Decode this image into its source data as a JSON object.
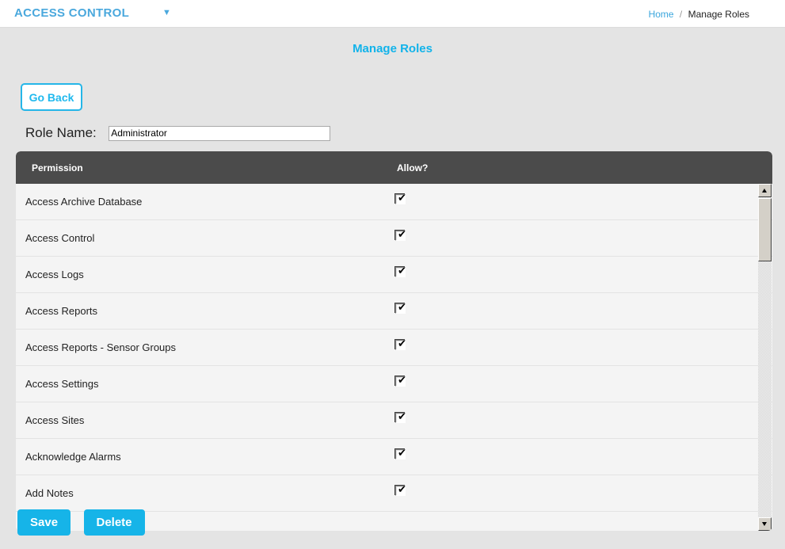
{
  "navbar": {
    "brand": "ACCESS CONTROL",
    "caret": "▼",
    "breadcrumb": {
      "home": "Home",
      "separator": "/",
      "current": "Manage Roles"
    }
  },
  "page": {
    "title": "Manage Roles",
    "go_back_label": "Go Back",
    "role_name_label": "Role Name:",
    "role_name_value": "Administrator",
    "role_name_placeholder": ""
  },
  "permissions_table": {
    "columns": {
      "permission": "Permission",
      "allow": "Allow?"
    },
    "rows": [
      {
        "permission": "Access Archive Database",
        "allow": true,
        "mark": "✔"
      },
      {
        "permission": "Access Control",
        "allow": true,
        "mark": "✔"
      },
      {
        "permission": "Access Logs",
        "allow": true,
        "mark": "✔"
      },
      {
        "permission": "Access Reports",
        "allow": true,
        "mark": "✔"
      },
      {
        "permission": "Access Reports - Sensor Groups",
        "allow": true,
        "mark": "✔"
      },
      {
        "permission": "Access Settings",
        "allow": true,
        "mark": "✔"
      },
      {
        "permission": "Access Sites",
        "allow": true,
        "mark": "✔"
      },
      {
        "permission": "Acknowledge Alarms",
        "allow": true,
        "mark": "✔"
      },
      {
        "permission": "Add Notes",
        "allow": true,
        "mark": "✔"
      }
    ]
  },
  "footer": {
    "save_label": "Save",
    "delete_label": "Delete"
  },
  "colors": {
    "brand": "#4aa8dd",
    "accent": "#16b4e8",
    "title": "#11b3ea",
    "page_background": "#e4e4e4",
    "table_header": "#4b4b4b",
    "row_background": "#f4f4f4",
    "link": "#3aa6dd"
  }
}
